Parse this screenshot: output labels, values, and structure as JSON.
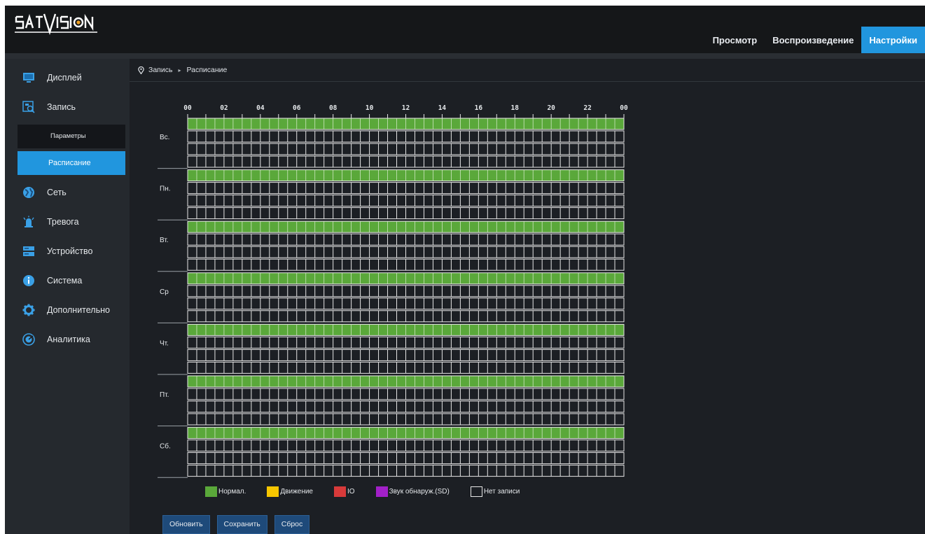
{
  "brand": {
    "logo_text": "SATVISION"
  },
  "topnav": {
    "items": [
      {
        "label": "Просмотр"
      },
      {
        "label": "Воспроизведение"
      },
      {
        "label": "Настройки"
      }
    ],
    "active": "Настройки"
  },
  "sidebar": {
    "items": [
      {
        "label": "Дисплей",
        "icon": "monitor-icon"
      },
      {
        "label": "Запись",
        "icon": "record-icon"
      },
      {
        "label": "Сеть",
        "icon": "globe-icon"
      },
      {
        "label": "Тревога",
        "icon": "alarm-icon"
      },
      {
        "label": "Устройство",
        "icon": "device-icon"
      },
      {
        "label": "Система",
        "icon": "info-icon"
      },
      {
        "label": "Дополнительно",
        "icon": "gear-icon"
      },
      {
        "label": "Аналитика",
        "icon": "analytics-icon"
      }
    ],
    "record_sub": [
      {
        "label": "Параметры"
      },
      {
        "label": "Расписание"
      }
    ]
  },
  "breadcrumb": {
    "parent": "Запись",
    "sep": "▸",
    "current": "Расписание"
  },
  "schedule": {
    "hour_labels": [
      "00",
      "02",
      "04",
      "06",
      "08",
      "10",
      "12",
      "14",
      "16",
      "18",
      "20",
      "22",
      "00"
    ],
    "days": [
      "Вс.",
      "Пн.",
      "Вт.",
      "Ср",
      "Чт.",
      "Пт.",
      "Сб."
    ],
    "rows_per_day": 4,
    "cells_per_hour": 2,
    "fill_rows": {
      "Normal": [
        0
      ]
    }
  },
  "legend": [
    {
      "label": "Нормал.",
      "color": "#5aa83a"
    },
    {
      "label": "Движение",
      "color": "#f7c600"
    },
    {
      "label": "IO",
      "color": "#d83a3a"
    },
    {
      "label": "Звук обнаруж.(SD)",
      "color": "#a220c8"
    },
    {
      "label": "Нет записи",
      "color": "none"
    }
  ],
  "buttons": {
    "refresh": "Обновить",
    "save": "Сохранить",
    "reset": "Сброс"
  },
  "colors": {
    "accent": "#2196de",
    "normal": "#5aa83a",
    "grid": "#e6e6e6"
  }
}
